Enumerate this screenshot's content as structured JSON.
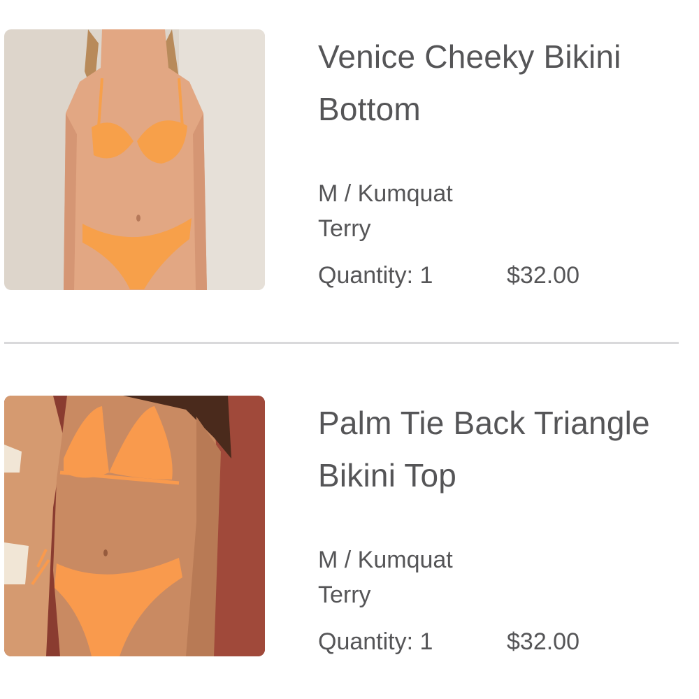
{
  "items": [
    {
      "title": "Venice Cheeky Bikini Bottom",
      "variant": "M / Kumquat Terry",
      "quantity_label": "Quantity: 1",
      "price": "$32.00",
      "image": {
        "background": "#ddd5cb",
        "swimsuit_color": "#f7a04a",
        "skin_color": "#e2a783"
      }
    },
    {
      "title": "Palm Tie Back Triangle Bikini Top",
      "variant": "M / Kumquat Terry",
      "quantity_label": "Quantity: 1",
      "price": "$32.00",
      "image": {
        "background": "#8a3c30",
        "swimsuit_color": "#f99a4d",
        "skin_color": "#c98a62"
      }
    }
  ]
}
